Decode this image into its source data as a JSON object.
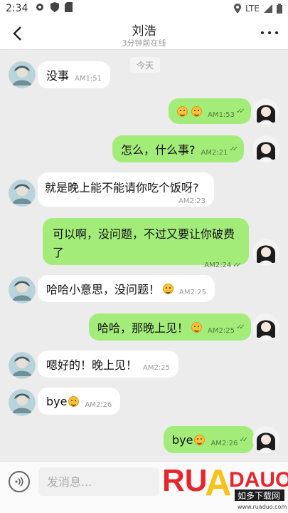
{
  "status": {
    "time": "2:34",
    "network": "LTE"
  },
  "header": {
    "title": "刘浩",
    "subtitle": "3分钟前在线"
  },
  "chat": {
    "date_label": "今天",
    "messages": [
      {
        "side": "in",
        "text": "没事",
        "time": "AM1:51"
      },
      {
        "side": "out",
        "text": "",
        "emoji_count": 2,
        "time": "AM1:53"
      },
      {
        "side": "out",
        "text": "怎么，什么事?",
        "time": "AM2:21"
      },
      {
        "side": "in",
        "text": "就是晚上能不能请你吃个饭呀?",
        "time": "AM2:23"
      },
      {
        "side": "out",
        "text": "可以啊，没问题，不过又要让你破费了",
        "time": "AM2:24"
      },
      {
        "side": "in",
        "text": "哈哈小意思，没问题！",
        "emoji_count": 1,
        "time": "AM2:25"
      },
      {
        "side": "out",
        "text": "哈哈，那晚上见！",
        "emoji_count": 1,
        "time": "AM2:25"
      },
      {
        "side": "in",
        "text": "嗯好的！晚上见！",
        "time": "AM2:25"
      },
      {
        "side": "in",
        "text": "bye",
        "emoji_count": 1,
        "time": "AM2:26"
      },
      {
        "side": "out",
        "text": "bye",
        "emoji_count": 1,
        "time": "AM2:26"
      }
    ]
  },
  "input": {
    "placeholder": "发消息..."
  },
  "watermark": {
    "brand": "RUADAUO",
    "cn": "如多下载网",
    "url": "www.ruaduo.com"
  },
  "colors": {
    "out_bubble": "#a4ec7a",
    "in_bubble": "#ffffff",
    "background": "#ececec"
  }
}
